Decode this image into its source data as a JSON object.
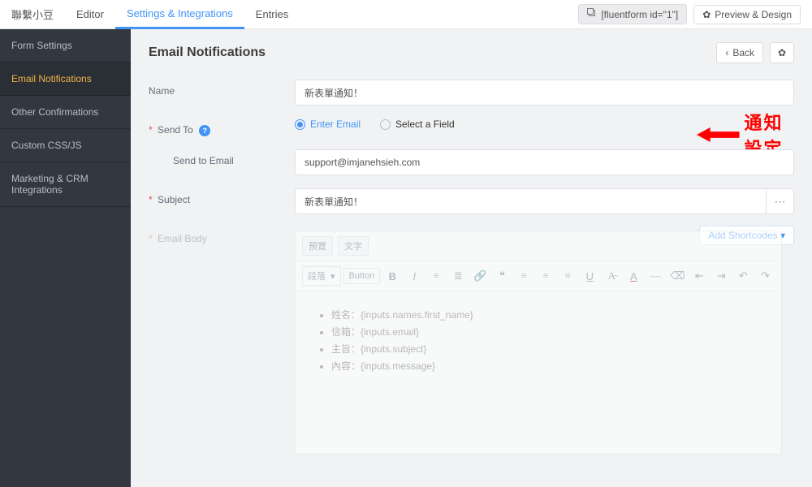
{
  "header": {
    "brand": "聯繫小豆",
    "tabs": [
      {
        "label": "Editor",
        "active": false
      },
      {
        "label": "Settings & Integrations",
        "active": true
      },
      {
        "label": "Entries",
        "active": false
      }
    ],
    "shortcode": "[fluentform id=\"1\"]",
    "preview_btn": "Preview & Design"
  },
  "sidebar": {
    "items": [
      {
        "label": "Form Settings",
        "active": false
      },
      {
        "label": "Email Notifications",
        "active": true
      },
      {
        "label": "Other Confirmations",
        "active": false
      },
      {
        "label": "Custom CSS/JS",
        "active": false
      },
      {
        "label": "Marketing & CRM Integrations",
        "active": false
      }
    ]
  },
  "page": {
    "title": "Email Notifications",
    "back_label": "Back"
  },
  "form": {
    "name_label": "Name",
    "name_value": "新表單通知！",
    "sendto_label": "Send To",
    "enter_email_label": "Enter Email",
    "select_field_label": "Select a Field",
    "send_to_email_label": "Send to Email",
    "send_to_email_value": "support@imjanehsieh.com",
    "subject_label": "Subject",
    "subject_value": "新表單通知！",
    "email_body_label": "Email Body",
    "add_shortcodes": "Add Shortcodes",
    "editor_tabs": {
      "visual": "預覽",
      "text": "文字"
    },
    "editor_dropdown": "段落",
    "editor_button": "Button",
    "body_lines": [
      "姓名：{inputs.names.first_name}",
      "信箱：{inputs.email}",
      "主旨：{inputs.subject}",
      "內容：{inputs.message}"
    ]
  },
  "callout": {
    "text": "通知設定"
  }
}
